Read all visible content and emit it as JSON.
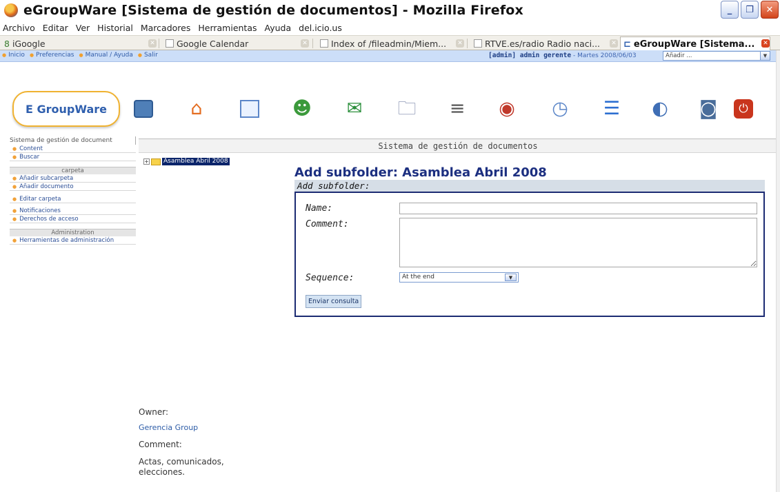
{
  "window": {
    "title": "eGroupWare [Sistema de gestión de documentos] - Mozilla Firefox",
    "buttons": {
      "minimize": "_",
      "maximize": "❐",
      "close": "✕"
    }
  },
  "menu": [
    "Archivo",
    "Editar",
    "Ver",
    "Historial",
    "Marcadores",
    "Herramientas",
    "Ayuda",
    "del.icio.us"
  ],
  "tabs": [
    {
      "label": "iGoogle",
      "icon": "igoogle-icon"
    },
    {
      "label": "Google Calendar",
      "icon": "calendar-icon"
    },
    {
      "label": "Index of /fileadmin/Miem...",
      "icon": "page-icon"
    },
    {
      "label": "RTVE.es/radio Radio naci...",
      "icon": "page-icon"
    },
    {
      "label": "eGroupWare [Sistema...",
      "icon": "egroupware-icon",
      "active": true
    }
  ],
  "egw": {
    "topnav": [
      "Inicio",
      "Preferencias",
      "Manual / Ayuda",
      "Salir"
    ],
    "user": "[admin] admin gerente",
    "date": " - Martes 2008/06/03",
    "add_select": "Añadir ...",
    "logo": "E GroupWare",
    "apps": [
      "apps-overview-icon",
      "home-icon",
      "calendar-icon",
      "addressbook-icon",
      "email-icon",
      "filemanager-icon",
      "projects-icon",
      "timesheet-icon",
      "clock-icon",
      "list-icon",
      "wiki-icon",
      "news-icon",
      "logout-icon"
    ]
  },
  "sidebar": {
    "title": "Sistema de gestión de document",
    "top_links": [
      "Content",
      "Buscar"
    ],
    "sections": [
      {
        "title": "carpeta",
        "links": [
          "Añadir subcarpeta",
          "Añadir documento",
          "Editar carpeta",
          "Notificaciones",
          "Derechos de acceso"
        ]
      },
      {
        "title": "Administration",
        "links": [
          "Herramientas de administración"
        ]
      }
    ]
  },
  "main": {
    "header": "Sistema de gestión de documentos",
    "tree_folder": "Asamblea Abril 2008",
    "form_title": "Add subfolder: Asamblea Abril 2008",
    "section": "Add subfolder:",
    "fields": {
      "name_label": "Name:",
      "name_value": "",
      "comment_label": "Comment:",
      "comment_value": "",
      "sequence_label": "Sequence:",
      "sequence_value": "At the end",
      "submit": "Enviar consulta"
    },
    "owner_label": "Owner:",
    "owner_value": "Gerencia Group",
    "comment_label": "Comment:",
    "comment_value": "Actas, comunicados, elecciones."
  }
}
